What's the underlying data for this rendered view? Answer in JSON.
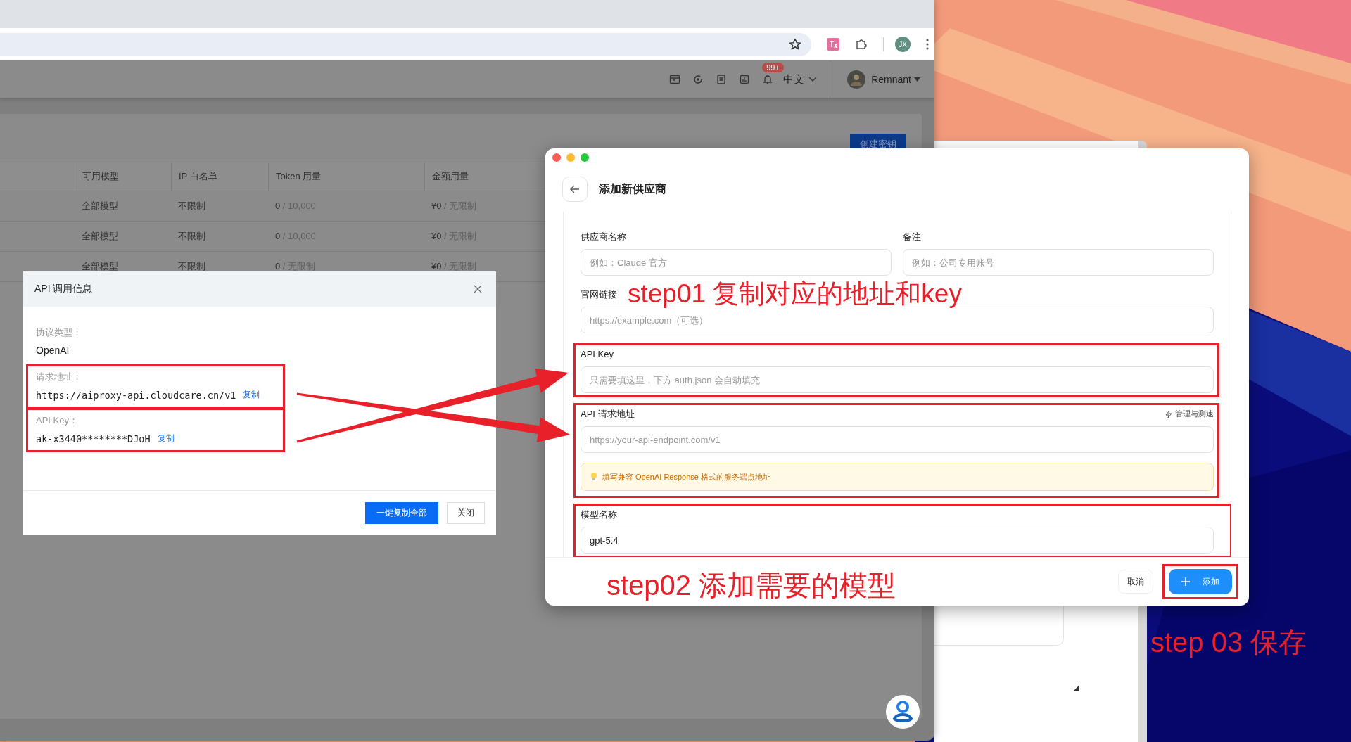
{
  "browser": {
    "profile_initials": "JX"
  },
  "app_header": {
    "notification_badge": "99+",
    "language": "中文",
    "user_name": "Remnant"
  },
  "keys_card": {
    "create_button": "创建密钥",
    "columns": [
      "可用模型",
      "IP 白名单",
      "Token 用量",
      "金额用量"
    ],
    "rows": [
      {
        "models": "全部模型",
        "ip_whitelist": "不限制",
        "token_used": "0",
        "token_limit": "/ 10,000",
        "amount_used": "¥0",
        "amount_limit": "/ 无限制"
      },
      {
        "models": "全部模型",
        "ip_whitelist": "不限制",
        "token_used": "0",
        "token_limit": "/ 10,000",
        "amount_used": "¥0",
        "amount_limit": "/ 无限制"
      },
      {
        "models": "全部模型",
        "ip_whitelist": "不限制",
        "token_used": "0",
        "token_limit": "/ 无限制",
        "amount_used": "¥0",
        "amount_limit": "/ 无限制"
      }
    ]
  },
  "api_dialog": {
    "title": "API 调用信息",
    "fields": [
      {
        "label": "协议类型：",
        "value": "OpenAI",
        "kind": "plain",
        "highlighted": false
      },
      {
        "label": "请求地址：",
        "value": "https://aiproxy-api.cloudcare.cn/v1",
        "copy_link": "复制",
        "kind": "mono",
        "highlighted": true
      },
      {
        "label": "API Key：",
        "value": "ak-x3440********DJoH",
        "copy_link": "复制",
        "kind": "mono",
        "highlighted": true
      }
    ],
    "buttons": [
      {
        "label": "一键复制全部",
        "kind": "primary"
      },
      {
        "label": "关闭",
        "kind": "default"
      }
    ]
  },
  "provider_modal": {
    "title": "添加新供应商",
    "fields": [
      {
        "label": "供应商名称",
        "placeholder": "例如：Claude 官方",
        "kind": "half",
        "highlighted": false
      },
      {
        "label": "备注",
        "placeholder": "例如：公司专用账号",
        "kind": "half",
        "highlighted": false
      },
      {
        "label": "官网链接",
        "placeholder": "https://example.com（可选）",
        "kind": "full",
        "highlighted": false
      },
      {
        "label": "API Key",
        "placeholder": "只需要填这里，下方 auth.json 会自动填充",
        "kind": "full",
        "highlighted": true
      },
      {
        "label": "API 请求地址",
        "placeholder": "https://your-api-endpoint.com/v1",
        "action": "管理与测速",
        "hint": "填写兼容 OpenAI Response 格式的服务端点地址",
        "kind": "full",
        "highlighted": true
      },
      {
        "label": "模型名称",
        "value": "gpt-5.4",
        "kind": "full",
        "highlighted": true
      }
    ],
    "buttons": [
      {
        "label": "取消",
        "kind": "default",
        "highlighted": false
      },
      {
        "label": "添加",
        "kind": "primary",
        "highlighted": true
      }
    ]
  },
  "annotations": [
    {
      "text": "step01 复制对应的地址和key"
    },
    {
      "text": "step02 添加需要的模型"
    },
    {
      "text": "step 03 保存"
    }
  ]
}
